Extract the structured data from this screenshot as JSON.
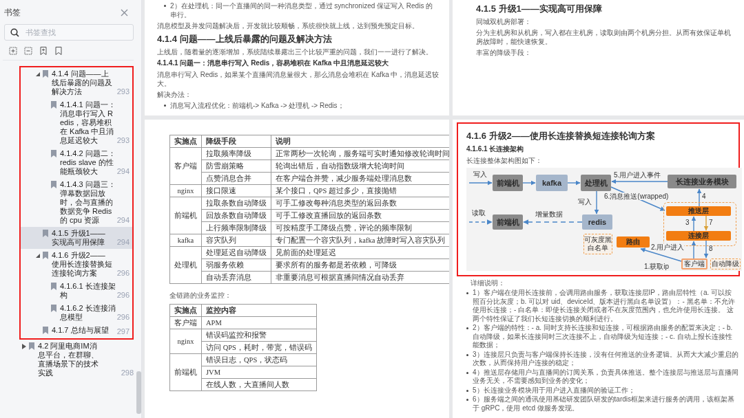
{
  "sidebar": {
    "title": "书签",
    "search": {
      "placeholder": "书签查找"
    },
    "outline": [
      {
        "highlighted": true,
        "children": [
          {
            "title": "4.1.4 问题——上线后暴露的问题及解决方法",
            "page": "293",
            "selected": false,
            "expanded": true,
            "children": [
              {
                "title": "4.1.4.1 问题一：消息串行写入 Redis，容易堆积在 Kafka 中且消息延迟较大",
                "page": "293",
                "selected": false
              },
              {
                "title": "4.1.4.2 问题二：redis slave 的性能瓶颈较大",
                "page": "294",
                "selected": false
              },
              {
                "title": "4.1.4.3 问题三：弹幕数据回放时，会与直播的数据竞争 Redis 的 cpu 资源",
                "page": "294",
                "selected": false
              }
            ]
          },
          {
            "title": "4.1.5 升级1——实现高可用保障",
            "page": "294",
            "selected": true
          },
          {
            "title": "4.1.6 升级2——使用长连接替换短连接轮询方案",
            "page": "296",
            "selected": false,
            "expanded": true,
            "children": [
              {
                "title": "4.1.6.1 长连接架构",
                "page": "296",
                "selected": false
              },
              {
                "title": "4.1.6.2 长连接消息模型",
                "page": "296",
                "selected": false
              }
            ]
          },
          {
            "title": "4.1.7 总结与展望",
            "page": "297",
            "selected": false
          }
        ]
      },
      {
        "title": "4.2 阿里电商IM消息平台，在群聊、直播场景下的技术实践",
        "page": "298",
        "selected": false,
        "expanded": false
      }
    ]
  },
  "pages": [
    {
      "blocks": [
        {
          "kind": "bullet",
          "text": "2）在处理机：同一个直播间的同一种消息类型，通过 synchronized 保证写入 Redis 的串行。"
        },
        {
          "kind": "paragraph",
          "text": "消息模型及并发问题解决后，开发就比较顺畅，系统很快就上线，达到预先预定目标。"
        },
        {
          "kind": "heading",
          "text": "4.1.4 问题——上线后暴露的问题及解决方法"
        },
        {
          "kind": "paragraph",
          "text": "上线后，随着量的逐渐增加，系统陆续暴露出三个比较严重的问题，我们一一进行了解决。"
        },
        {
          "kind": "subheading",
          "text": "4.1.4.1 问题一：消息串行写入 Redis，容易堆积在 Kafka 中且消息延迟较大"
        },
        {
          "kind": "paragraph",
          "text": "消息串行写入 Redis，如果某个直播间消息量很大，那么消息会堆积在 Kafka 中，消息延迟较大。"
        },
        {
          "kind": "paragraph",
          "text": "解决办法："
        },
        {
          "kind": "bullet",
          "text": "消息写入流程优化：前端机-> Kafka -> 处理机 -> Redis；"
        }
      ]
    },
    {
      "blocks": [
        {
          "kind": "heading",
          "text": "4.1.5 升级1——实现高可用保障"
        },
        {
          "kind": "paragraph",
          "text": "同城双机房部署："
        },
        {
          "kind": "paragraph",
          "text": "分为主机房和从机房，写入都在主机房，读取则由两个机房分担。从而有效保证单机房故障时，能快速恢复。"
        },
        {
          "kind": "paragraph",
          "text": "丰富的降级手段："
        }
      ]
    },
    {
      "blocks": [
        {
          "kind": "table",
          "columns": [
            "实施点",
            "降级手段",
            "说明"
          ],
          "groups": [
            {
              "point": "客户端",
              "rows": [
                [
                  "拉取频率降级",
                  "正常两秒一次轮询，服务端可实时通知修改轮询时间"
                ],
                [
                  "防雪崩策略",
                  "轮询出错后，自动指数级增大轮询时间"
                ],
                [
                  "点赞消息合并",
                  "在客户端合并赞，减少服务端处理消息数"
                ]
              ]
            },
            {
              "point": "nginx",
              "rows": [
                [
                  "接口限速",
                  "某个接口，QPS 超过多少，直接抛错"
                ]
              ]
            },
            {
              "point": "前端机",
              "rows": [
                [
                  "拉取条数自动降级",
                  "可手工修改每种消息类型的返回条数"
                ],
                [
                  "回放条数自动降级",
                  "可手工修改直播回放的返回条数"
                ],
                [
                  "上行频率限制降级",
                  "可按精度手工降级点赞，评论的频率限制"
                ]
              ]
            },
            {
              "point": "kafka",
              "rows": [
                [
                  "容灾队列",
                  "专门配置一个容灾队列，kafka 故障时写入容灾队列"
                ]
              ]
            },
            {
              "point": "处理机",
              "rows": [
                [
                  "处理延迟自动降级",
                  "见前面的处理延迟"
                ],
                [
                  "弱服务依赖",
                  "要求所有的服务都是若依赖，可降级"
                ],
                [
                  "自动丢弃消息",
                  "非重要消息可根据直播间情况自动丢弃"
                ]
              ]
            }
          ]
        },
        {
          "kind": "paragraph",
          "text": "全链路的业务监控："
        },
        {
          "kind": "table",
          "columns": [
            "实施点",
            "监控内容"
          ],
          "groups": [
            {
              "point": "客户端",
              "rows": [
                [
                  "APM"
                ]
              ]
            },
            {
              "point": "nginx",
              "rows": [
                [
                  "错误码监控和报警"
                ],
                [
                  "访问 QPS，耗时，带宽，错误码"
                ]
              ]
            },
            {
              "point": "前端机",
              "rows": [
                [
                  "错误日志，QPS，状态码"
                ],
                [
                  "JVM"
                ],
                [
                  "在线人数，大直播间人数"
                ]
              ]
            }
          ]
        }
      ]
    },
    {
      "blocks": [
        {
          "kind": "section",
          "highlighted": true,
          "blocks": [
            {
              "kind": "heading",
              "text": "4.1.6 升级2——使用长连接替换短连接轮询方案"
            },
            {
              "kind": "subheading",
              "text": "4.1.6.1 长连接架构"
            },
            {
              "kind": "paragraph",
              "text": "长连接整体架构图如下："
            },
            {
              "kind": "diagram",
              "nodes": [
                {
                  "label": "前端机",
                  "kind": "gray"
                },
                {
                  "label": "kafka",
                  "kind": "blue"
                },
                {
                  "label": "处理机",
                  "kind": "gray"
                },
                {
                  "label": "长连接业务模块",
                  "kind": "gray"
                },
                {
                  "label": "前端机",
                  "kind": "gray"
                },
                {
                  "label": "redis",
                  "kind": "blue"
                },
                {
                  "label": "推送层",
                  "kind": "orange"
                },
                {
                  "label": "连接层",
                  "kind": "orange"
                },
                {
                  "label": "路由",
                  "kind": "orange"
                },
                {
                  "label": "可灰度黑白名单",
                  "kind": "dashed"
                },
                {
                  "label": "客户端",
                  "kind": "client"
                },
                {
                  "label": "自动降级",
                  "kind": "dashed"
                }
              ],
              "edge_labels": [
                "写入",
                "5.用户进入事件",
                "6.消息推送(wrapped)",
                "写入",
                "读取",
                "增量数据",
                "4",
                "3",
                "7",
                "2.用户进入",
                "8",
                "1.获取ip"
              ]
            }
          ]
        },
        {
          "kind": "paragraph",
          "text": "详细说明："
        },
        {
          "kind": "bullet",
          "text": "1）客户端在使用长连接前，会调用路由服务，获取连接层IP，路由层特性（a. 可以按照百分比灰度；b. 可以对 uid、deviceId、版本进行黑白名单设置）：- 黑名单：不允许使用长连接；- 白名单：即使长连接关闭或者不在灰度范围内，也允许使用长连接。 这两个特性保证了我们长短连接切换的顺利进行。"
        },
        {
          "kind": "bullet",
          "text": "2）客户端的特性：- a. 同时支持长连接和短连接，可根据路由服务的配置来决定；- b. 自动降级，如果长连接同时三次连接不上，自动降级为短连接；- c. 自动上报长连接性能数据；"
        },
        {
          "kind": "bullet",
          "text": "3）连接层只负责与客户端保持长连接，没有任何推送的业务逻辑。从而大大减少重启的次数，从而保持用户连接的稳定；"
        },
        {
          "kind": "bullet",
          "text": "4）推送层存储用户与直播间的订阅关系，负责具体推送。整个连接层与推送层与直播间业务无关，不需要感知到业务的变化；"
        },
        {
          "kind": "bullet",
          "text": "5）长连接业务模块用于用户进入直播间的验证工作；"
        },
        {
          "kind": "bullet",
          "text": "6）服务端之间的通讯使用基础研发团队研发的tardis框架来进行服务的调用，该框架基于 gRPC，使用 etcd 做服务发现。"
        }
      ]
    }
  ]
}
